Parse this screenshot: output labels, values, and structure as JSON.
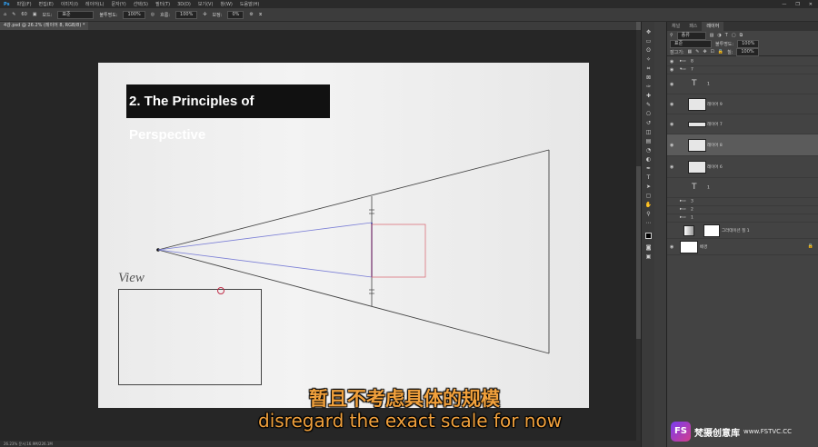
{
  "menubar": {
    "items": [
      "파일(F)",
      "편집(E)",
      "이미지(I)",
      "레이어(L)",
      "문자(Y)",
      "선택(S)",
      "필터(T)",
      "3D(D)",
      "보기(V)",
      "창(W)",
      "도움말(H)"
    ],
    "minimize": "—",
    "restore": "❐",
    "close": "✕"
  },
  "options": {
    "brush_size": "60",
    "mode_label": "모드:",
    "mode_value": "표준",
    "opacity_label": "불투명도:",
    "opacity_value": "100%",
    "flow_label": "흐름:",
    "flow_value": "100%",
    "smoothing_label": "보정:",
    "smoothing_value": "0%"
  },
  "document": {
    "tab_label": "4강.psd @ 26.2% (레이어 8, RGB/8) *"
  },
  "canvas": {
    "title": "2. The Principles of Perspective",
    "view_label": "View"
  },
  "subtitles": {
    "cn": "暂且不考虑具体的规模",
    "en": "disregard the exact scale for now"
  },
  "statusbar": {
    "text": "26.23%    문서:16.9M/226.1M"
  },
  "panel": {
    "tabs": [
      "채널",
      "패스",
      "레이어"
    ],
    "active_tab": "레이어",
    "filter_label": "종류",
    "blend_mode": "표준",
    "opacity_label": "불투명도:",
    "opacity_value": "100%",
    "lock_label": "잠그기:",
    "fill_label": "칠:",
    "fill_value": "100%",
    "layers": [
      {
        "name": "8",
        "type": "group"
      },
      {
        "name": "7",
        "type": "group"
      },
      {
        "name": "1",
        "type": "text"
      },
      {
        "name": "레이어 9",
        "type": "pixel"
      },
      {
        "name": "레이어 7",
        "type": "pixel"
      },
      {
        "name": "레이어 8",
        "type": "pixel",
        "selected": true
      },
      {
        "name": "레이어 6",
        "type": "pixel"
      },
      {
        "name": "1",
        "type": "text"
      },
      {
        "name": "3",
        "type": "group"
      },
      {
        "name": "2",
        "type": "group"
      },
      {
        "name": "1",
        "type": "group"
      },
      {
        "name": "그라데이션 칠 1",
        "type": "fill"
      },
      {
        "name": "배경",
        "type": "background"
      }
    ]
  },
  "watermark": {
    "logo": "FS",
    "text": "梵摄创意库",
    "url": "www.FSTVC.CC"
  },
  "colors": {
    "title_bg": "#111111",
    "subtitle": "#f0a03c",
    "vanishing_line": "#7b7fd6",
    "square": "#d9606a"
  },
  "icons": {
    "cursor": "brush-cursor-circle"
  }
}
